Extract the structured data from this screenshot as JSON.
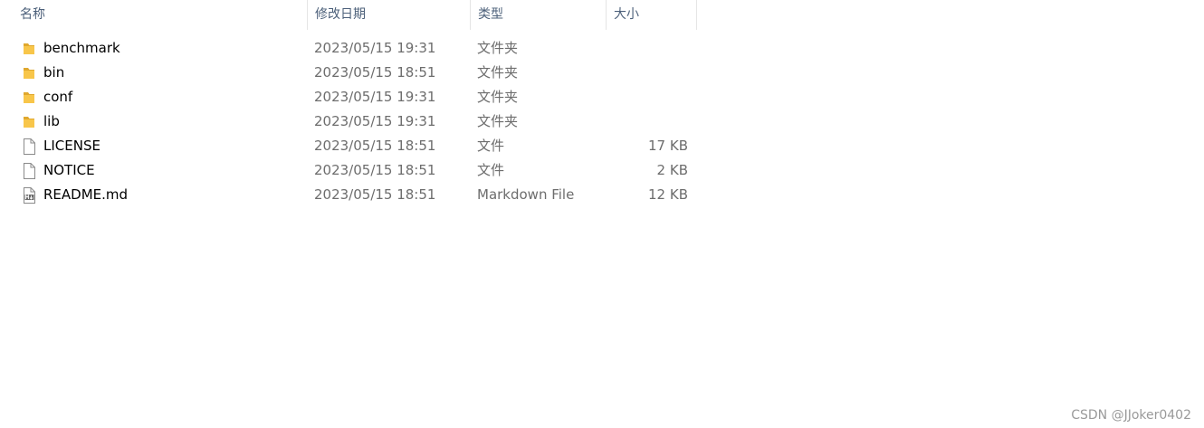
{
  "columns": {
    "name": "名称",
    "date": "修改日期",
    "type": "类型",
    "size": "大小"
  },
  "sort": {
    "column": "name",
    "direction": "ascending",
    "icon": "chevron-up-icon"
  },
  "files": [
    {
      "name": "benchmark",
      "date": "2023/05/15 19:31",
      "type": "文件夹",
      "size": "",
      "icon": "folder-icon"
    },
    {
      "name": "bin",
      "date": "2023/05/15 18:51",
      "type": "文件夹",
      "size": "",
      "icon": "folder-icon"
    },
    {
      "name": "conf",
      "date": "2023/05/15 19:31",
      "type": "文件夹",
      "size": "",
      "icon": "folder-icon"
    },
    {
      "name": "lib",
      "date": "2023/05/15 19:31",
      "type": "文件夹",
      "size": "",
      "icon": "folder-icon"
    },
    {
      "name": "LICENSE",
      "date": "2023/05/15 18:51",
      "type": "文件",
      "size": "17 KB",
      "icon": "file-icon"
    },
    {
      "name": "NOTICE",
      "date": "2023/05/15 18:51",
      "type": "文件",
      "size": "2 KB",
      "icon": "file-icon"
    },
    {
      "name": "README.md",
      "date": "2023/05/15 18:51",
      "type": "Markdown File",
      "size": "12 KB",
      "icon": "markdown-file-icon"
    }
  ],
  "watermark": "CSDN @JJoker0402",
  "colors": {
    "folder": "#f8c64a",
    "folder_dark": "#e0a82e",
    "header_text": "#4c607a",
    "detail_text": "#6d6d6d"
  }
}
